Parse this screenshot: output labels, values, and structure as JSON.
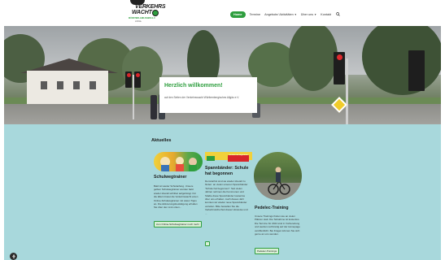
{
  "header": {
    "logo_line1": "VERKEHRS",
    "logo_line2": "WACHT",
    "logo_sub": "MÜNSTERLAND-RHEIN E.V.",
    "logo_sub2": "LOKAL"
  },
  "nav": {
    "items": [
      {
        "label": "Home",
        "active": true,
        "dropdown": false
      },
      {
        "label": "Termine",
        "active": false,
        "dropdown": false
      },
      {
        "label": "Angebote/ Aktivitäten",
        "active": false,
        "dropdown": true
      },
      {
        "label": "Über uns",
        "active": false,
        "dropdown": true
      },
      {
        "label": "Kontakt",
        "active": false,
        "dropdown": false
      }
    ],
    "search_icon": "search-icon"
  },
  "hero": {
    "title": "Herzlich willkommen!",
    "text": "auf den Seiten der Verkehrswacht Württembergisches Allgäu e.V."
  },
  "section": {
    "title": "Aktuelles"
  },
  "cards": [
    {
      "title": "Schulwegtrainer",
      "text": "Bald ist wieder Schulanfang. Unsere gelben Schulwegtrainer werden bald wieder überall sichtbar aufgehängt. Für die Eltern bietet die Verkehrswacht einen Online-Schulwegtrainer mit vielen Tipps an. Die Aktivierungsbestätigung erhalten Sie über den Link unten...",
      "button": "zum Online-Schulwegtrainer noch mehr"
    },
    {
      "title": "Spannbänder: Schule hat begonnen",
      "banner": "Schule hat begonnen",
      "text": "Demnächst sind sie wieder überall zu finden: an vielen unseren Spannbänder 'Schule hat begonnen!'. Seit vielen Jahren nehmen die Kommunen und Städte diese Spannbänder kostenlos über uns erhalten. Auch dieses Jahr konnten wir wieder neue Spannbänder verteilen. Bitte bestellen Sie die Verkehrssicherheit dieser Hinweise und ...",
      "button": ""
    },
    {
      "title": "Pedelec-Training",
      "text": "Unsere Trainings finden wie an vielen Plätzen statt. Die Teilnahme ist kostenlos. Die Termine für 2024 sind in Vorbereitung und werden rechtzeitig auf der Homepage veröffentlicht. Bei Fragen können Sie sich gerne an uns wenden.",
      "button": "Pedelec-Trainings"
    }
  ],
  "colors": {
    "brand_green": "#2e9e3e",
    "section_bg": "#a8d8dc"
  }
}
